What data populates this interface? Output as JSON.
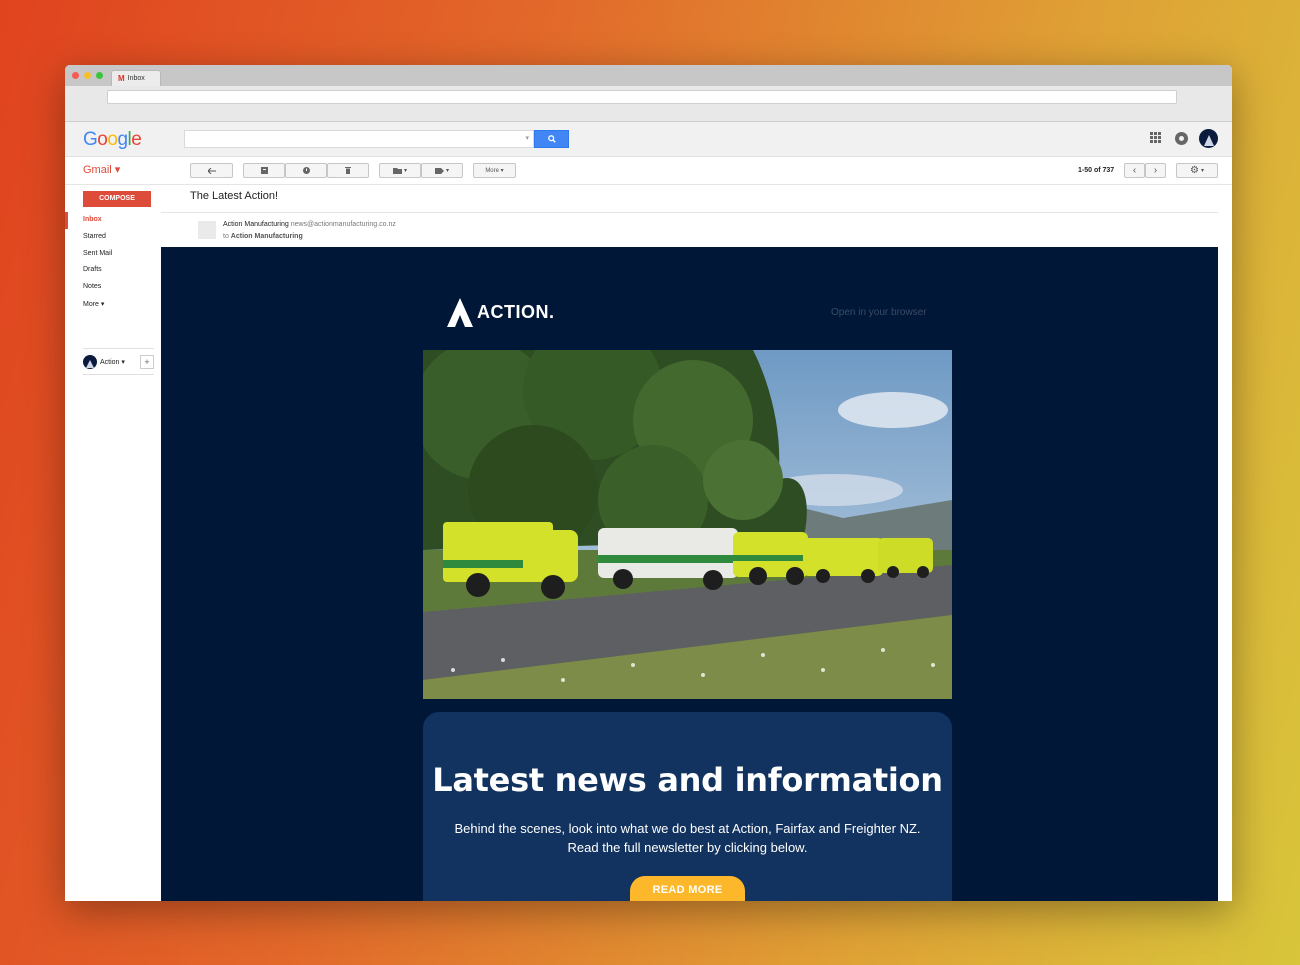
{
  "browser": {
    "tab_title": "Inbox",
    "tab_icon": "M"
  },
  "header": {
    "logo": [
      "G",
      "o",
      "o",
      "g",
      "l",
      "e"
    ],
    "logo_colors": [
      "#4285f4",
      "#ea4335",
      "#fbbc05",
      "#4285f4",
      "#34a853",
      "#ea4335"
    ],
    "search_placeholder": ""
  },
  "toolbar": {
    "gmail_label": "Gmail ▾",
    "more_label": "More ▾",
    "pager": "1-50 of 737"
  },
  "sidebar": {
    "compose_label": "COMPOSE",
    "items": [
      {
        "label": "Inbox",
        "active": true
      },
      {
        "label": "Starred"
      },
      {
        "label": "Sent Mail"
      },
      {
        "label": "Drafts"
      },
      {
        "label": "Notes"
      },
      {
        "label": "More ▾"
      }
    ],
    "hangout_user": "Action ▾",
    "add_label": "+"
  },
  "message": {
    "subject": "The Latest Action!",
    "sender_name": "Action Manufacturing",
    "sender_email": "news@actionmanufacturing.co.nz",
    "to_prefix": "to",
    "to_name": "Action Manufacturing"
  },
  "email": {
    "logo_text": "ACTION.",
    "open_browser": "Open in your browser",
    "card_title": "Latest news and information",
    "card_text": "Behind the scenes, look into what we do best at Action, Fairfax and Freighter NZ. Read the full newsletter by clicking below.",
    "cta": "READ MORE",
    "colors": {
      "background": "#011737",
      "card": "#12325f",
      "cta": "#fcb82a"
    }
  }
}
